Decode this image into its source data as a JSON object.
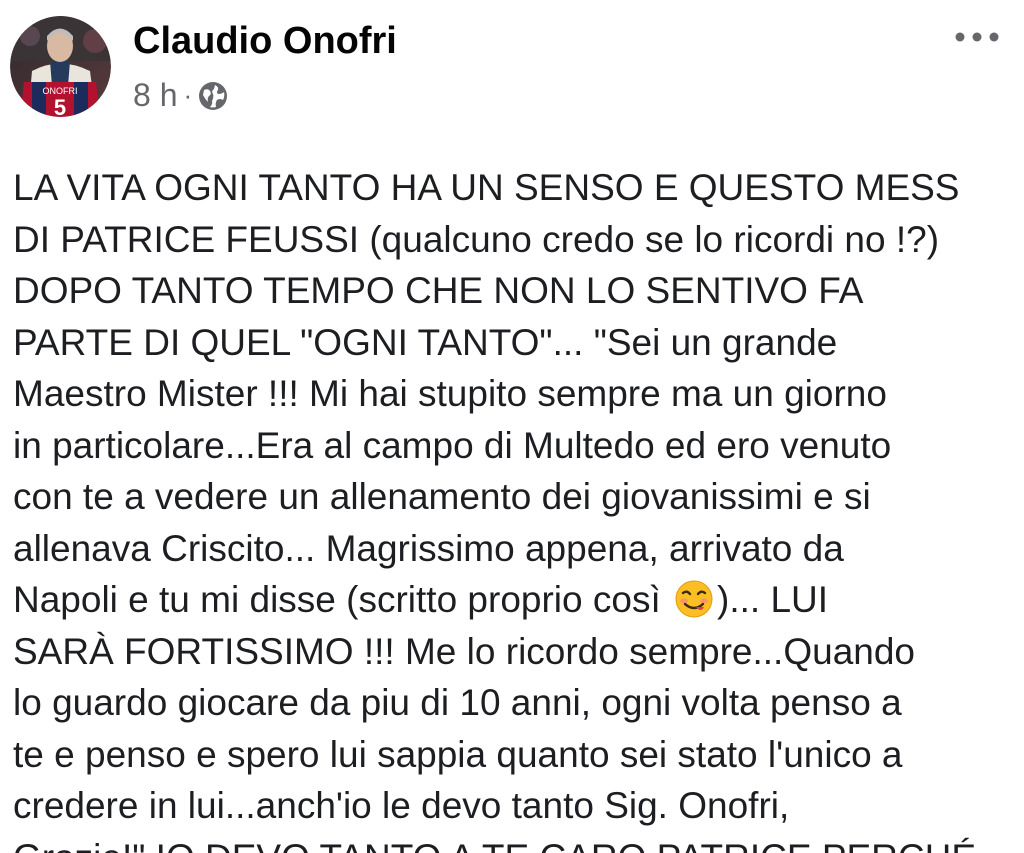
{
  "post": {
    "author": {
      "name": "Claudio Onofri",
      "avatar_jersey_name": "ONOFRI",
      "avatar_jersey_number": "5"
    },
    "timestamp": "8 h",
    "separator": "·",
    "privacy_icon": "globe-icon",
    "more_icon": "more-options-icon",
    "body": {
      "line_01": "LA VITA OGNI TANTO HA UN SENSO E QUESTO MESS",
      "line_02": "DI PATRICE FEUSSI (qualcuno credo se lo ricordi no !?)",
      "line_03": "DOPO TANTO TEMPO CHE NON LO SENTIVO FA",
      "line_04": "PARTE DI QUEL \"OGNI TANTO\"... \"Sei un grande",
      "line_05": "Maestro Mister !!! Mi hai stupito sempre ma un giorno",
      "line_06": "in particolare...Era al campo di Multedo ed ero venuto",
      "line_07": "con te a vedere un allenamento dei giovanissimi e si",
      "line_08": "allenava Criscito... Magrissimo appena, arrivato da",
      "line_09_a": "Napoli e tu mi disse (scritto proprio così ",
      "line_09_emoji": "face-savoring-food-emoji",
      "line_09_b": ")... LUI",
      "line_10": "SARÀ FORTISSIMO !!! Me lo ricordo sempre...Quando",
      "line_11": "lo guardo giocare da piu di 10 anni, ogni volta penso a",
      "line_12": "te e penso e spero lui sappia quanto sei stato l'unico a",
      "line_13": "credere in lui...anch'io le devo tanto Sig. Onofri,",
      "line_14": "Grazie!\" IO DEVO TANTO A TE CARO PATRICE PERCHÉ"
    }
  },
  "colors": {
    "text_primary": "#1c1e21",
    "text_secondary": "#65676b",
    "background": "#ffffff",
    "jersey_red": "#b3122e",
    "jersey_blue": "#1d2b5c"
  }
}
